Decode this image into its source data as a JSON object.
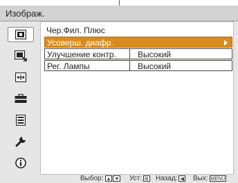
{
  "window": {
    "title": "Изображ."
  },
  "sidebar": {
    "items": [
      {
        "icon": "picture-icon",
        "active": true
      },
      {
        "icon": "picture-adjust-icon",
        "active": false
      },
      {
        "icon": "screen-icon",
        "active": false
      },
      {
        "icon": "toolbox-icon",
        "active": false
      },
      {
        "icon": "menu-list-icon",
        "active": false
      },
      {
        "icon": "wrench-icon",
        "active": false
      },
      {
        "icon": "info-icon",
        "active": false
      }
    ]
  },
  "panel": {
    "title": "Чер.Фил. Плюс",
    "rows": [
      {
        "label": "Усоверш. диафр.",
        "value": "",
        "selected": true
      },
      {
        "label": "Улучшение контр.",
        "value": "Высокий",
        "selected": false
      },
      {
        "label": "Рег. Лампы",
        "value": "Высокий",
        "selected": false
      }
    ]
  },
  "footer": {
    "select_label": "Выбор:",
    "set_label": "Уст:",
    "back_label": "Назад:",
    "exit_label": "Вых:",
    "menu_key": "MENU"
  },
  "colors": {
    "accent": "#d88c1d",
    "background": "#e6e6e6",
    "title_bar": "#d3d3d3"
  }
}
